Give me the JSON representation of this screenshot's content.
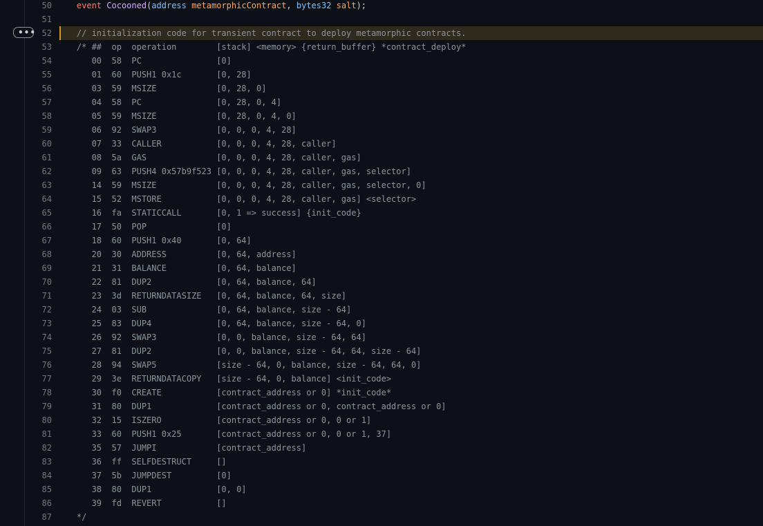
{
  "expand_button": {
    "label": "•••"
  },
  "lines": [
    {
      "n": "50",
      "segs": [
        [
          "",
          "    "
        ],
        [
          "kw",
          "event"
        ],
        [
          "",
          " "
        ],
        [
          "fn",
          "Cocooned"
        ],
        [
          "",
          "("
        ],
        [
          "ty",
          "address"
        ],
        [
          "",
          " "
        ],
        [
          "id",
          "metamorphicContract"
        ],
        [
          "",
          ", "
        ],
        [
          "ty",
          "bytes32"
        ],
        [
          "",
          " "
        ],
        [
          "id",
          "salt"
        ],
        [
          "",
          ");"
        ]
      ]
    },
    {
      "n": "51",
      "segs": []
    },
    {
      "n": "52",
      "highlight": true,
      "segs": [
        [
          "cm",
          "    // initialization code for transient contract to deploy metamorphic contracts."
        ]
      ]
    },
    {
      "n": "53",
      "segs": [
        [
          "cm",
          "    /* ##  op  operation        [stack] <memory> {return_buffer} *contract_deploy*"
        ]
      ]
    },
    {
      "n": "54",
      "segs": [
        [
          "cm",
          "       00  58  PC               [0]"
        ]
      ]
    },
    {
      "n": "55",
      "segs": [
        [
          "cm",
          "       01  60  PUSH1 0x1c       [0, 28]"
        ]
      ]
    },
    {
      "n": "56",
      "segs": [
        [
          "cm",
          "       03  59  MSIZE            [0, 28, 0]"
        ]
      ]
    },
    {
      "n": "57",
      "segs": [
        [
          "cm",
          "       04  58  PC               [0, 28, 0, 4]"
        ]
      ]
    },
    {
      "n": "58",
      "segs": [
        [
          "cm",
          "       05  59  MSIZE            [0, 28, 0, 4, 0]"
        ]
      ]
    },
    {
      "n": "59",
      "segs": [
        [
          "cm",
          "       06  92  SWAP3            [0, 0, 0, 4, 28]"
        ]
      ]
    },
    {
      "n": "60",
      "segs": [
        [
          "cm",
          "       07  33  CALLER           [0, 0, 0, 4, 28, caller]"
        ]
      ]
    },
    {
      "n": "61",
      "segs": [
        [
          "cm",
          "       08  5a  GAS              [0, 0, 0, 4, 28, caller, gas]"
        ]
      ]
    },
    {
      "n": "62",
      "segs": [
        [
          "cm",
          "       09  63  PUSH4 0x57b9f523 [0, 0, 0, 4, 28, caller, gas, selector]"
        ]
      ]
    },
    {
      "n": "63",
      "segs": [
        [
          "cm",
          "       14  59  MSIZE            [0, 0, 0, 4, 28, caller, gas, selector, 0]"
        ]
      ]
    },
    {
      "n": "64",
      "segs": [
        [
          "cm",
          "       15  52  MSTORE           [0, 0, 0, 4, 28, caller, gas] <selector>"
        ]
      ]
    },
    {
      "n": "65",
      "segs": [
        [
          "cm",
          "       16  fa  STATICCALL       [0, 1 => success] {init_code}"
        ]
      ]
    },
    {
      "n": "66",
      "segs": [
        [
          "cm",
          "       17  50  POP              [0]"
        ]
      ]
    },
    {
      "n": "67",
      "segs": [
        [
          "cm",
          "       18  60  PUSH1 0x40       [0, 64]"
        ]
      ]
    },
    {
      "n": "68",
      "segs": [
        [
          "cm",
          "       20  30  ADDRESS          [0, 64, address]"
        ]
      ]
    },
    {
      "n": "69",
      "segs": [
        [
          "cm",
          "       21  31  BALANCE          [0, 64, balance]"
        ]
      ]
    },
    {
      "n": "70",
      "segs": [
        [
          "cm",
          "       22  81  DUP2             [0, 64, balance, 64]"
        ]
      ]
    },
    {
      "n": "71",
      "segs": [
        [
          "cm",
          "       23  3d  RETURNDATASIZE   [0, 64, balance, 64, size]"
        ]
      ]
    },
    {
      "n": "72",
      "segs": [
        [
          "cm",
          "       24  03  SUB              [0, 64, balance, size - 64]"
        ]
      ]
    },
    {
      "n": "73",
      "segs": [
        [
          "cm",
          "       25  83  DUP4             [0, 64, balance, size - 64, 0]"
        ]
      ]
    },
    {
      "n": "74",
      "segs": [
        [
          "cm",
          "       26  92  SWAP3            [0, 0, balance, size - 64, 64]"
        ]
      ]
    },
    {
      "n": "75",
      "segs": [
        [
          "cm",
          "       27  81  DUP2             [0, 0, balance, size - 64, 64, size - 64]"
        ]
      ]
    },
    {
      "n": "76",
      "segs": [
        [
          "cm",
          "       28  94  SWAP5            [size - 64, 0, balance, size - 64, 64, 0]"
        ]
      ]
    },
    {
      "n": "77",
      "segs": [
        [
          "cm",
          "       29  3e  RETURNDATACOPY   [size - 64, 0, balance] <init_code>"
        ]
      ]
    },
    {
      "n": "78",
      "segs": [
        [
          "cm",
          "       30  f0  CREATE           [contract_address or 0] *init_code*"
        ]
      ]
    },
    {
      "n": "79",
      "segs": [
        [
          "cm",
          "       31  80  DUP1             [contract_address or 0, contract_address or 0]"
        ]
      ]
    },
    {
      "n": "80",
      "segs": [
        [
          "cm",
          "       32  15  ISZERO           [contract_address or 0, 0 or 1]"
        ]
      ]
    },
    {
      "n": "81",
      "segs": [
        [
          "cm",
          "       33  60  PUSH1 0x25       [contract_address or 0, 0 or 1, 37]"
        ]
      ]
    },
    {
      "n": "82",
      "segs": [
        [
          "cm",
          "       35  57  JUMPI            [contract_address]"
        ]
      ]
    },
    {
      "n": "83",
      "segs": [
        [
          "cm",
          "       36  ff  SELFDESTRUCT     []"
        ]
      ]
    },
    {
      "n": "84",
      "segs": [
        [
          "cm",
          "       37  5b  JUMPDEST         [0]"
        ]
      ]
    },
    {
      "n": "85",
      "segs": [
        [
          "cm",
          "       38  80  DUP1             [0, 0]"
        ]
      ]
    },
    {
      "n": "86",
      "segs": [
        [
          "cm",
          "       39  fd  REVERT           []"
        ]
      ]
    },
    {
      "n": "87",
      "segs": [
        [
          "cm",
          "    */"
        ]
      ]
    }
  ]
}
